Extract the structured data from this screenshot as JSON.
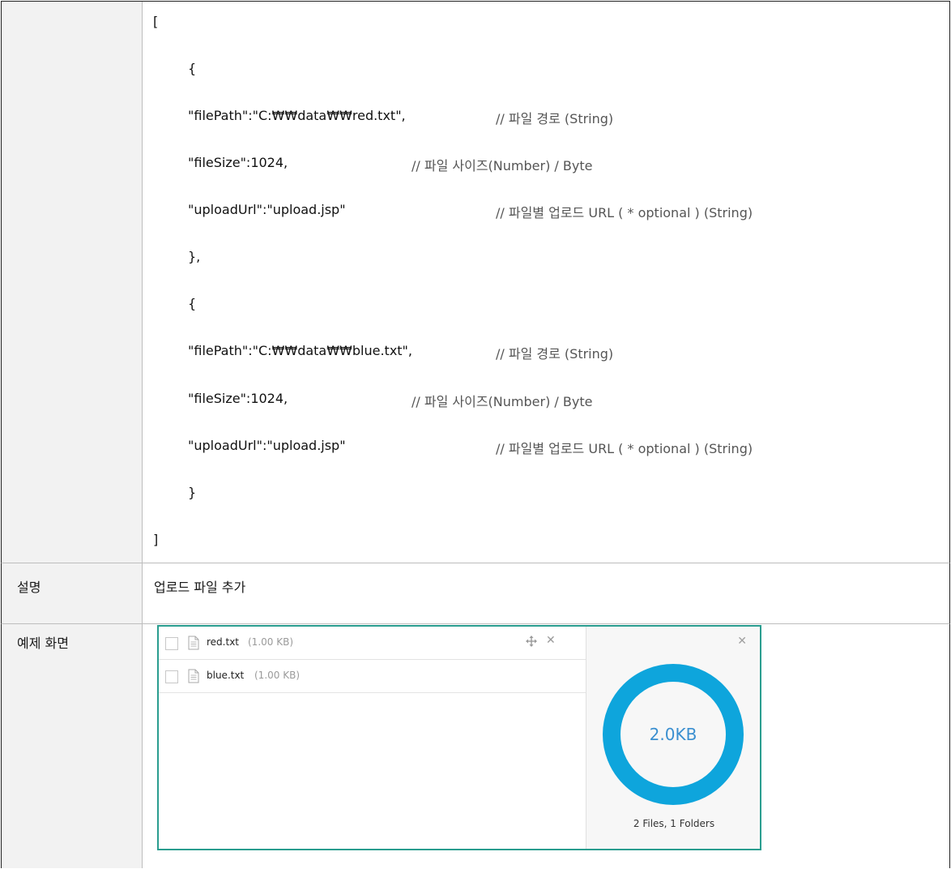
{
  "code_block": {
    "lines": [
      {
        "code": "[",
        "comment": ""
      },
      {
        "code": "{",
        "comment": ""
      },
      {
        "code": "\"filePath\":\"C:₩₩data₩₩red.txt\",",
        "comment": "// 파일 경로 (String)"
      },
      {
        "code": "\"fileSize\":1024,",
        "comment": "// 파일 사이즈(Number) / Byte"
      },
      {
        "code": "\"uploadUrl\":\"upload.jsp\"",
        "comment": "// 파일별 업로드 URL ( * optional ) (String)"
      },
      {
        "code": "},",
        "comment": ""
      },
      {
        "code": "{",
        "comment": ""
      },
      {
        "code": "\"filePath\":\"C:₩₩data₩₩blue.txt\",",
        "comment": "// 파일 경로 (String)"
      },
      {
        "code": "\"fileSize\":1024,",
        "comment": "// 파일 사이즈(Number) / Byte"
      },
      {
        "code": "\"uploadUrl\":\"upload.jsp\"",
        "comment": "// 파일별 업로드 URL ( * optional ) (String)"
      },
      {
        "code": "}",
        "comment": ""
      },
      {
        "code": "]",
        "comment": ""
      }
    ]
  },
  "description": {
    "label": "설명",
    "text": "업로드 파일 추가"
  },
  "example": {
    "label": "예제 화면",
    "files": [
      {
        "name": "red.txt",
        "size": "(1.00 KB)",
        "icon": "document-icon"
      },
      {
        "name": "blue.txt",
        "size": "(1.00 KB)",
        "icon": "document-icon"
      }
    ],
    "summary": {
      "total_size": "2.0KB",
      "counts": "2 Files, 1 Folders",
      "ring_color": "#0ea5dc"
    },
    "border_color": "#2a9d8f"
  }
}
